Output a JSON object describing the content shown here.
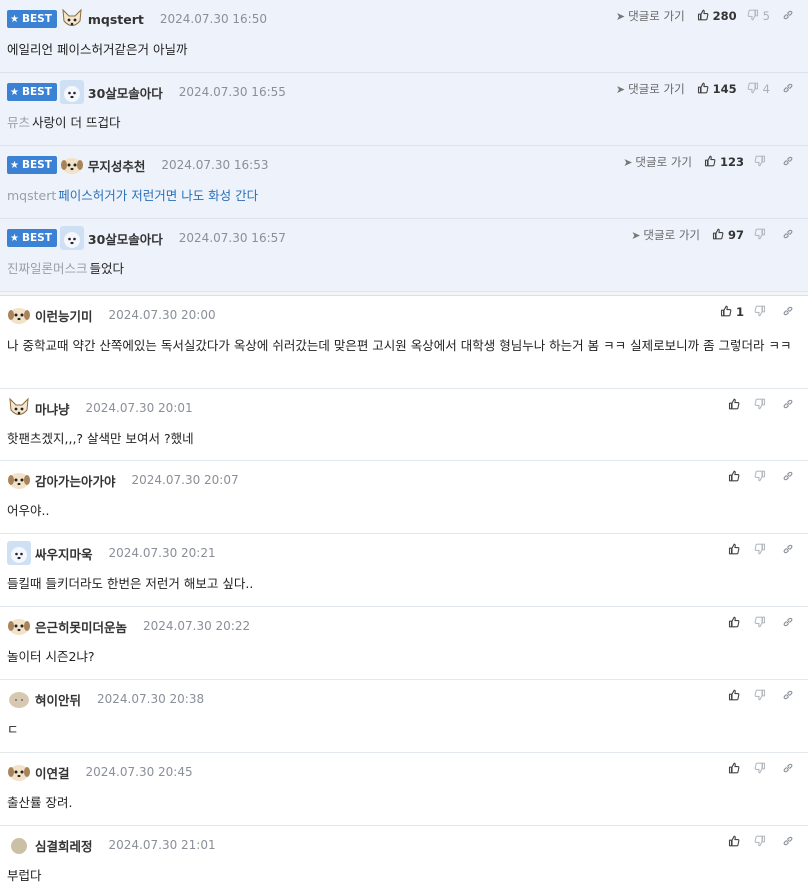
{
  "labels": {
    "best": "BEST",
    "goto": "댓글로 가기"
  },
  "best_comments": [
    {
      "nick": "mqstert",
      "date": "2024.07.30 16:50",
      "avatar": "fox-face-icon",
      "text": "에일리언 페이스허거같은거 아닐까",
      "mention": "",
      "likes": "280",
      "dislikes": "5",
      "blue": false
    },
    {
      "nick": "30살모솔아다",
      "date": "2024.07.30 16:55",
      "avatar": "white-dog-icon",
      "text": "사랑이 더 뜨겁다",
      "mention": "뮤츠",
      "likes": "145",
      "dislikes": "4",
      "blue": false
    },
    {
      "nick": "무지성추천",
      "date": "2024.07.30 16:53",
      "avatar": "puppy-face-icon",
      "text": "페이스허거가 저런거면 나도 화성 간다",
      "mention": "mqstert",
      "likes": "123",
      "dislikes": "",
      "blue": true
    },
    {
      "nick": "30살모솔아다",
      "date": "2024.07.30 16:57",
      "avatar": "white-dog-icon",
      "text": "들었다",
      "mention": "진짜일론머스크",
      "likes": "97",
      "dislikes": "",
      "blue": false
    }
  ],
  "comments": [
    {
      "nick": "이런능기미",
      "date": "2024.07.30 20:00",
      "avatar": "puppy-face-icon",
      "text": "나 중학교때 약간 산쪽에있는 독서실갔다가 옥상에 쉬러갔는데 맞은편 고시원 옥상에서 대학생 형님누나 하는거 봄 ㅋㅋ 실제로보니까 좀 그렇더라 ㅋㅋ",
      "likes": "1"
    },
    {
      "nick": "마냐냥",
      "date": "2024.07.30 20:01",
      "avatar": "fox-face-icon",
      "text": "핫팬츠겠지,,,? 살색만 보여서 ?했네",
      "likes": ""
    },
    {
      "nick": "감아가는아가야",
      "date": "2024.07.30 20:07",
      "avatar": "puppy-face-icon",
      "text": "어우야..",
      "likes": ""
    },
    {
      "nick": "싸우지마욱",
      "date": "2024.07.30 20:21",
      "avatar": "white-dog-icon",
      "text": "들킬때 들키더라도 한번은 저런거 해보고 싶다..",
      "likes": ""
    },
    {
      "nick": "은근히못미더운놈",
      "date": "2024.07.30 20:22",
      "avatar": "puppy-face-icon",
      "text": "놀이터 시즌2냐?",
      "likes": ""
    },
    {
      "nick": "혀이안뒤",
      "date": "2024.07.30 20:38",
      "avatar": "egg-face-icon",
      "text": "ㄷ",
      "likes": ""
    },
    {
      "nick": "이연걸",
      "date": "2024.07.30 20:45",
      "avatar": "puppy-face-icon",
      "text": "출산률 장려.",
      "likes": ""
    },
    {
      "nick": "심결희레정",
      "date": "2024.07.30 21:01",
      "avatar": "egg-dot-icon",
      "text": "부럽다",
      "likes": ""
    }
  ]
}
